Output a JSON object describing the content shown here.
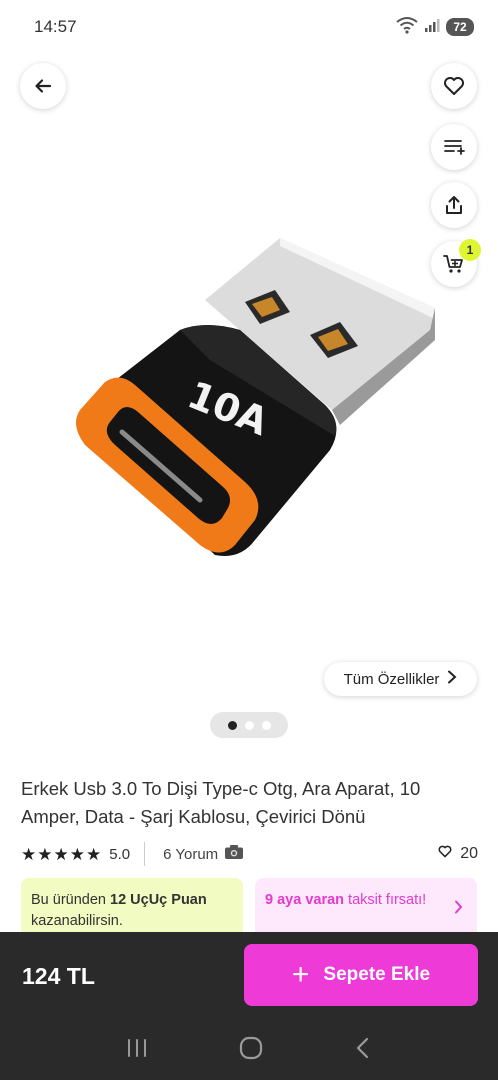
{
  "status_bar": {
    "time": "14:57",
    "battery": "72"
  },
  "product": {
    "title": "Erkek Usb 3.0 To Dişi Type-c Otg, Ara Aparat, 10 Amper, Data - Şarj Kablosu, Çevirici Dönü",
    "image_text": "10A",
    "rating": "5.0",
    "reviews": "6 Yorum",
    "likes": "20",
    "all_features_label": "Tüm Özellikler",
    "carousel": {
      "count": 3,
      "active": 0
    }
  },
  "cart": {
    "badge": "1"
  },
  "promo": {
    "left_prefix": "Bu üründen ",
    "left_bold": "12 UçUç Puan",
    "left_suffix": " kazanabilirsin.",
    "right_bold": "9 aya varan",
    "right_text": " taksit fırsatı!"
  },
  "footer": {
    "price": "124 TL",
    "add_to_cart_label": "Sepete Ekle",
    "plus": "+"
  },
  "icons": {
    "back": "arrow-left-icon",
    "favorite": "heart-icon",
    "compare": "list-plus-icon",
    "share": "share-icon",
    "cart": "cart-icon",
    "chevron": "chevron-right-icon",
    "camera": "camera-icon",
    "wifi": "wifi-icon",
    "signal": "signal-icon"
  },
  "colors": {
    "accent": "#ee3bd8",
    "bottom_bar": "#2a2a2a",
    "promo_green": "#f1fbc2",
    "promo_pink": "#fde9fb",
    "badge": "#dff531"
  }
}
